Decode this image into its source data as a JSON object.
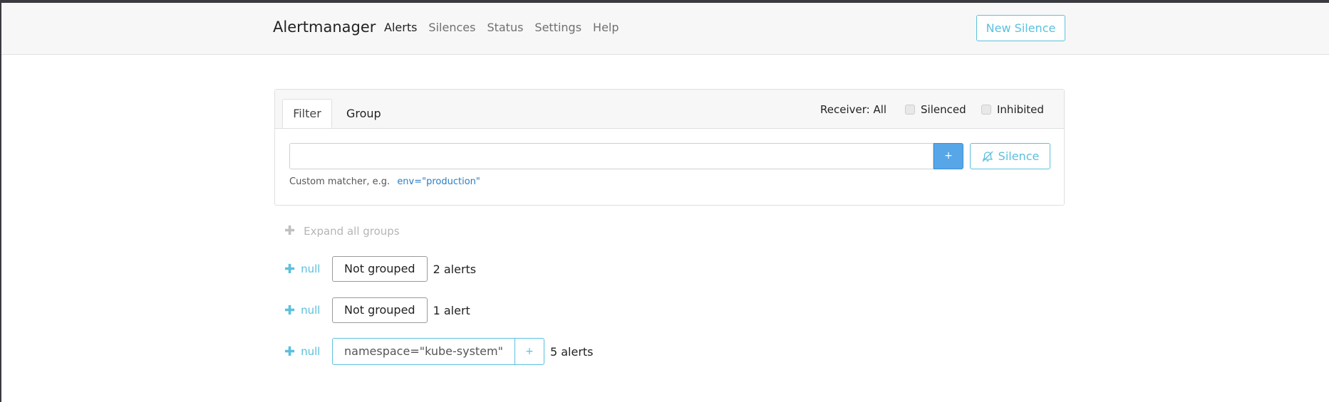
{
  "navbar": {
    "brand": "Alertmanager",
    "links": [
      "Alerts",
      "Silences",
      "Status",
      "Settings",
      "Help"
    ],
    "active": "Alerts",
    "new_silence": "New Silence"
  },
  "filter_card": {
    "tabs": [
      "Filter",
      "Group"
    ],
    "active_tab": "Filter",
    "receiver": "Receiver: All",
    "silenced_label": "Silenced",
    "silenced_checked": false,
    "inhibited_label": "Inhibited",
    "inhibited_checked": false,
    "input_value": "",
    "plus_label": "+",
    "silence_button": "Silence",
    "hint_text": "Custom matcher, e.g.",
    "hint_example": "env=\"production\""
  },
  "expand_all": "Expand all groups",
  "groups": [
    {
      "toggle": "null",
      "label": "Not grouped",
      "count": "2 alerts"
    },
    {
      "toggle": "null",
      "label": "Not grouped",
      "count": "1 alert"
    },
    {
      "toggle": "null",
      "label": "namespace=\"kube-system\"",
      "add": "+",
      "count": "5 alerts"
    }
  ],
  "colors": {
    "accent": "#5bc0de",
    "primary_button": "#56a6e8",
    "navbar_bg": "#f7f7f7"
  },
  "icons": {
    "plus": "plus-icon",
    "silence": "bell-slash-icon"
  }
}
